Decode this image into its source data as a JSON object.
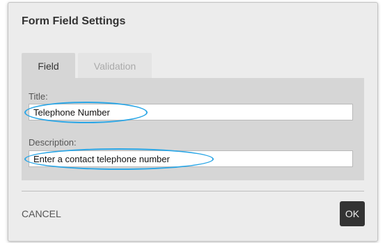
{
  "dialog": {
    "title": "Form Field Settings",
    "tabs": [
      {
        "label": "Field",
        "active": true
      },
      {
        "label": "Validation",
        "active": false
      }
    ],
    "fields": {
      "title_label": "Title:",
      "title_value": "Telephone Number",
      "description_label": "Description:",
      "description_value": "Enter a contact telephone number"
    },
    "buttons": {
      "cancel": "CANCEL",
      "ok": "OK"
    },
    "highlight_color": "#2aa6e6"
  }
}
